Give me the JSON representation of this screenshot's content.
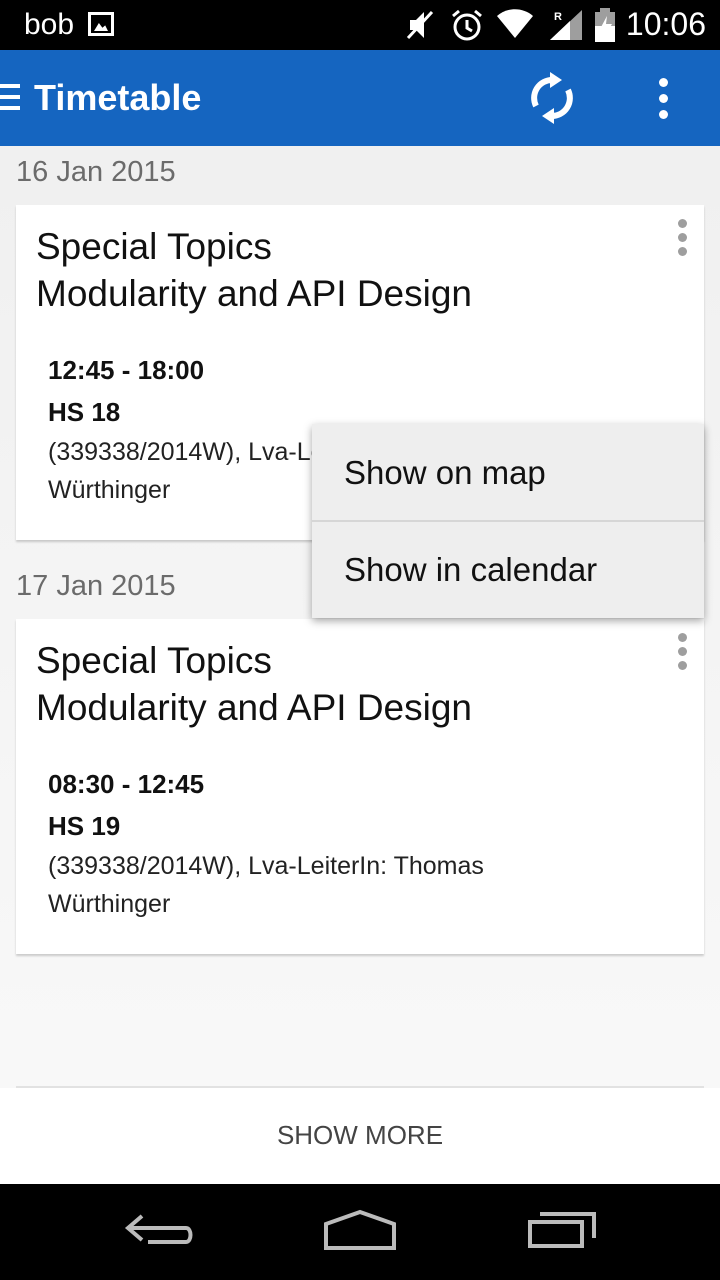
{
  "status_bar": {
    "carrier": "bob",
    "time": "10:06",
    "icons": [
      "image-icon",
      "mute-icon",
      "alarm-icon",
      "wifi-icon",
      "signal-icon",
      "battery-icon"
    ]
  },
  "app_bar": {
    "title": "Timetable",
    "icons": [
      "menu-icon",
      "sync-icon",
      "more-vert-icon"
    ],
    "color": "#1565c0"
  },
  "days": [
    {
      "date": "16 Jan 2015",
      "course_title_line1": "Special Topics",
      "course_title_line2": "Modularity and API Design",
      "time": "12:45 - 18:00",
      "room": "HS 18",
      "desc_line1": "(339338/2014W), Lva-LeiterIn: Thomas",
      "desc_line2": "Würthinger"
    },
    {
      "date": "17 Jan 2015",
      "course_title_line1": "Special Topics",
      "course_title_line2": "Modularity and API Design",
      "time": "08:30 - 12:45",
      "room": "HS 19",
      "desc_line1": "(339338/2014W), Lva-LeiterIn: Thomas",
      "desc_line2": "Würthinger"
    }
  ],
  "popup_menu": {
    "items": [
      "Show on map",
      "Show in calendar"
    ]
  },
  "footer": {
    "show_more": "SHOW MORE"
  },
  "nav_bar": {
    "icons": [
      "back-icon",
      "home-icon",
      "recents-icon"
    ]
  }
}
